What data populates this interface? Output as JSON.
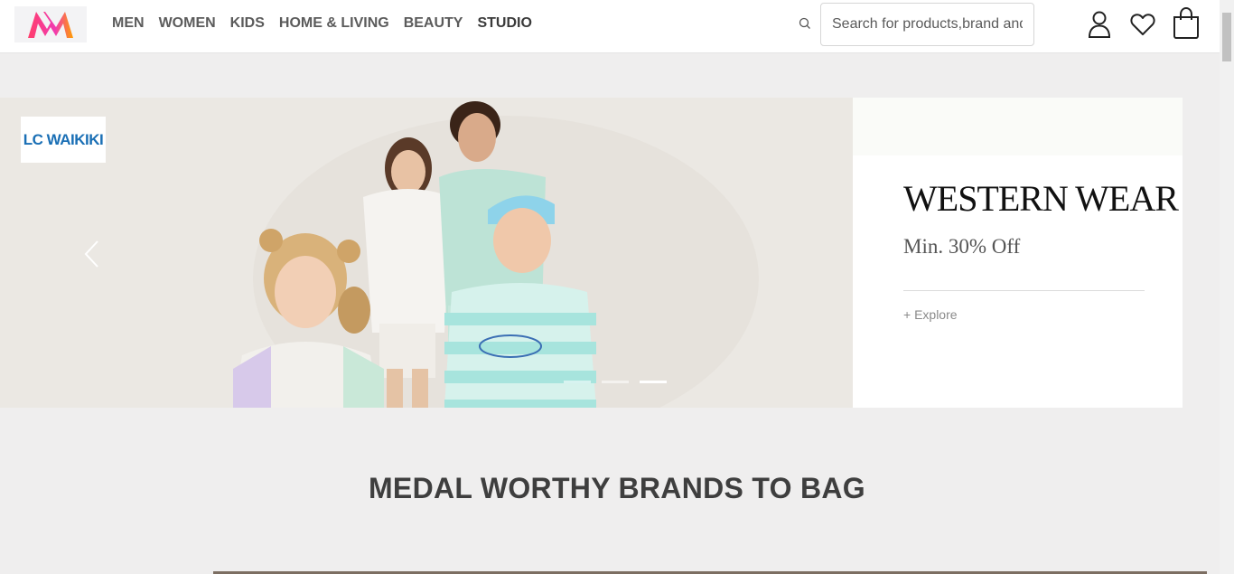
{
  "header": {
    "logo_alt": "Myntra",
    "nav": [
      {
        "label": "MEN"
      },
      {
        "label": "WOMEN"
      },
      {
        "label": "KIDS"
      },
      {
        "label": "HOME & LIVING"
      },
      {
        "label": "BEAUTY"
      },
      {
        "label": "STUDIO"
      }
    ],
    "search": {
      "placeholder": "Search for products,brand and more",
      "value": ""
    },
    "icons": {
      "search": "search-icon",
      "profile": "profile-icon",
      "wishlist": "heart-icon",
      "bag": "bag-icon"
    }
  },
  "banner": {
    "brand_badge": "LC WAIKIKI",
    "title": "WESTERN WEAR",
    "subtitle": "Min. 30% Off",
    "cta": "+ Explore",
    "slides_count": 3,
    "active_slide": 3
  },
  "section": {
    "title": "MEDAL WORTHY BRANDS TO BAG"
  },
  "colors": {
    "logo_pink": "#ff3f6c",
    "logo_orange": "#ff9f00",
    "brand_blue": "#1a6fb5",
    "page_bg": "#efeeee"
  }
}
